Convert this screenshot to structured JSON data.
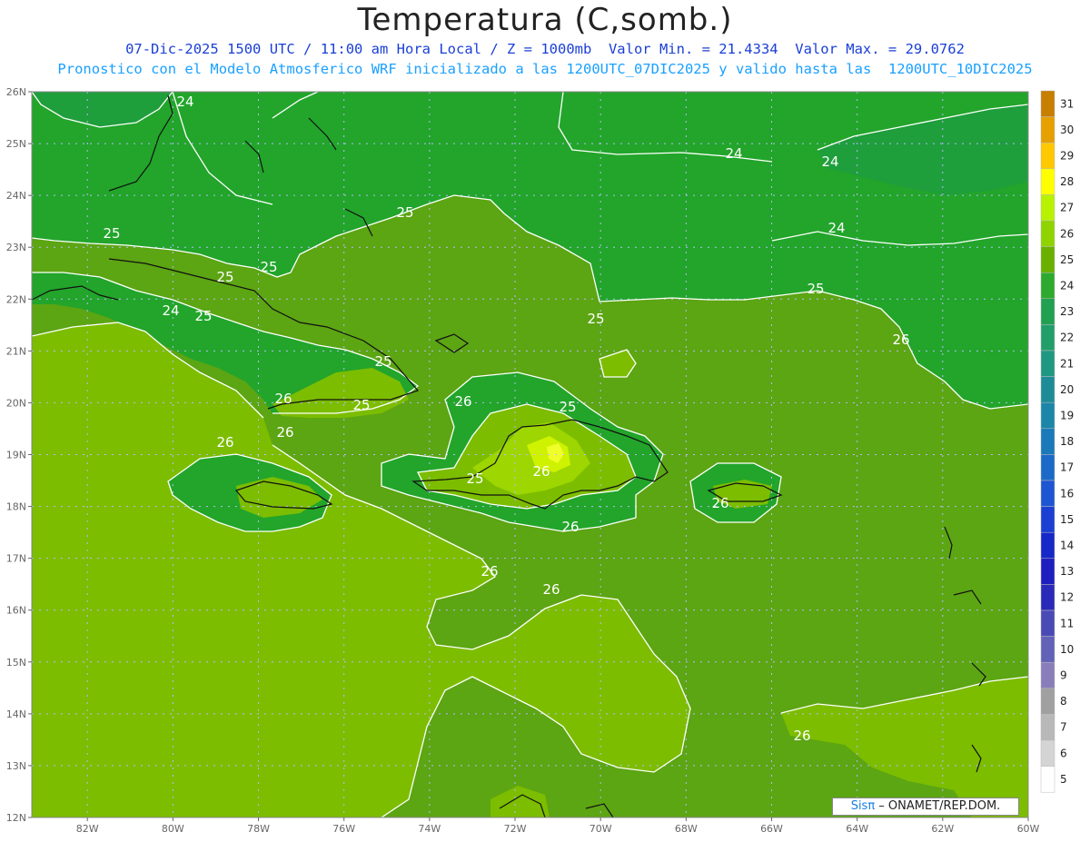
{
  "header": {
    "title": "Temperatura (C,somb.)",
    "subtitle_1": "07-Dic-2025 1500 UTC / 11:00 am Hora Local / Z = 1000mb  Valor Min. = 21.4334  Valor Max. = 29.0762",
    "subtitle_2": "Pronostico con el Modelo Atmosferico WRF inicializado a las 1200UTC_07DIC2025 y valido hasta las  1200UTC_10DIC2025"
  },
  "axes": {
    "lat_labels": [
      "26N",
      "25N",
      "24N",
      "23N",
      "22N",
      "21N",
      "20N",
      "19N",
      "18N",
      "17N",
      "16N",
      "15N",
      "14N",
      "13N",
      "12N"
    ],
    "lon_labels": [
      "82W",
      "80W",
      "78W",
      "76W",
      "74W",
      "72W",
      "70W",
      "68W",
      "66W",
      "64W",
      "62W",
      "60W"
    ],
    "lat_range": [
      12,
      26
    ],
    "lon_range": [
      -83.3,
      -60
    ]
  },
  "colors": {
    "c23": "#1f9e3c",
    "c24": "#22a52a",
    "c25": "#5ca513",
    "c26": "#7cbd00",
    "c27": "#9dd600",
    "c28": "#cff200",
    "c29": "#f0ff2a",
    "contour": "#ffffff",
    "coast": "#111111",
    "grid": "#b9b9ff"
  },
  "contour_labels": [
    "24",
    "24",
    "24",
    "24",
    "25",
    "25",
    "25",
    "25",
    "25",
    "25",
    "25",
    "24",
    "25",
    "26",
    "26",
    "25",
    "25",
    "26",
    "25",
    "26",
    "26",
    "26",
    "26",
    "26",
    "26",
    "26",
    "26"
  ],
  "colorbar": {
    "values": [
      "31",
      "30",
      "29",
      "28",
      "27",
      "26",
      "25",
      "24",
      "23",
      "22",
      "21",
      "20",
      "19",
      "18",
      "17",
      "16",
      "15",
      "14",
      "13",
      "12",
      "11",
      "10",
      "9",
      "8",
      "7",
      "6",
      "5"
    ],
    "colors": [
      "#c77f00",
      "#e5a000",
      "#ffc800",
      "#ffff00",
      "#b8f200",
      "#8fd400",
      "#6ab000",
      "#2eaa2e",
      "#22a052",
      "#229e6a",
      "#1f9882",
      "#1e8c96",
      "#1b86a8",
      "#1a79b8",
      "#1b6ac8",
      "#1d55d2",
      "#1a3fd2",
      "#1628c8",
      "#1e1ec0",
      "#2a2ab8",
      "#4a4ab6",
      "#6262b8",
      "#8a7eba",
      "#a0a0a0",
      "#b8b8b8",
      "#d4d4d4",
      "#ffffff"
    ]
  },
  "credit": {
    "brand": "Sisπ",
    "text": " – ONAMET/REP.DOM."
  }
}
